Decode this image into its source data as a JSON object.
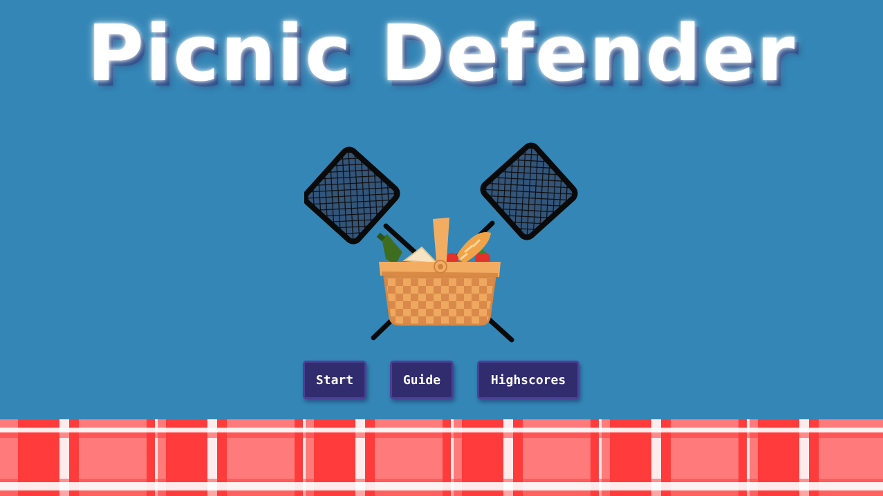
{
  "game": {
    "title": "Picnic Defender"
  },
  "menu": {
    "start_label": "Start",
    "guide_label": "Guide",
    "highscores_label": "Highscores"
  },
  "art": {
    "icons": [
      "fly-swatter-icon",
      "picnic-basket-icon"
    ]
  },
  "colors": {
    "background": "#3386b6",
    "button_fill": "#302c6e",
    "button_border": "#4d3f95",
    "tablecloth_red": "#ff3b3b",
    "tablecloth_pink": "#ff7a7a",
    "tablecloth_white": "#ffffff"
  }
}
